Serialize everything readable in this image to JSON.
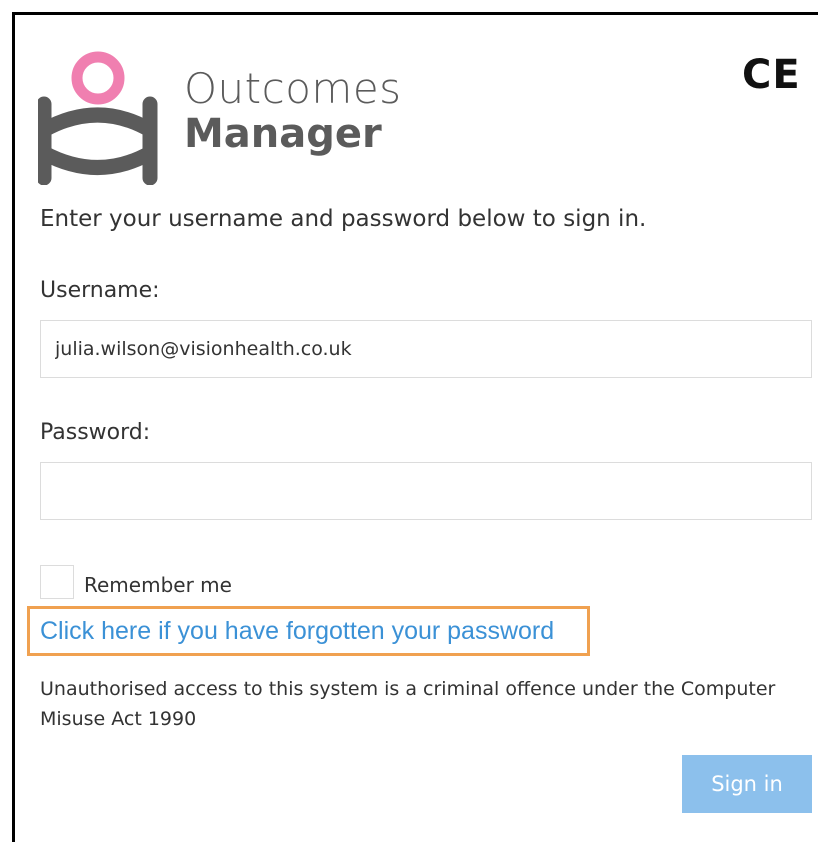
{
  "logo": {
    "word_line1": "Outcomes",
    "word_line2": "Manager",
    "pink": "#f07fb0",
    "grey": "#5b5b5b"
  },
  "certification_mark": "CE",
  "intro_text": "Enter your username and password below to sign in.",
  "username": {
    "label": "Username:",
    "value": "julia.wilson@visionhealth.co.uk"
  },
  "password": {
    "label": "Password:",
    "value": ""
  },
  "remember_me": {
    "label": "Remember me",
    "checked": false
  },
  "forgot_password_link": "Click here if you have forgotten your password",
  "legal_notice": "Unauthorised access to this system is a criminal offence under the Computer Misuse Act 1990",
  "sign_in_button": "Sign in",
  "colors": {
    "link": "#3b91d6",
    "highlight_border": "#f0a150",
    "button": "#8cc0ec"
  }
}
